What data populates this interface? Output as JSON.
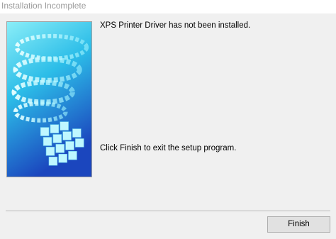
{
  "window": {
    "title": "Installation Incomplete"
  },
  "content": {
    "message_top": "XPS Printer Driver has not been installed.",
    "message_bottom": "Click Finish to exit the setup program."
  },
  "buttons": {
    "finish_label": "Finish"
  },
  "colors": {
    "banner_light": "#7fe8f6",
    "banner_mid": "#2ab4e6",
    "banner_dark": "#1c4fc2"
  }
}
